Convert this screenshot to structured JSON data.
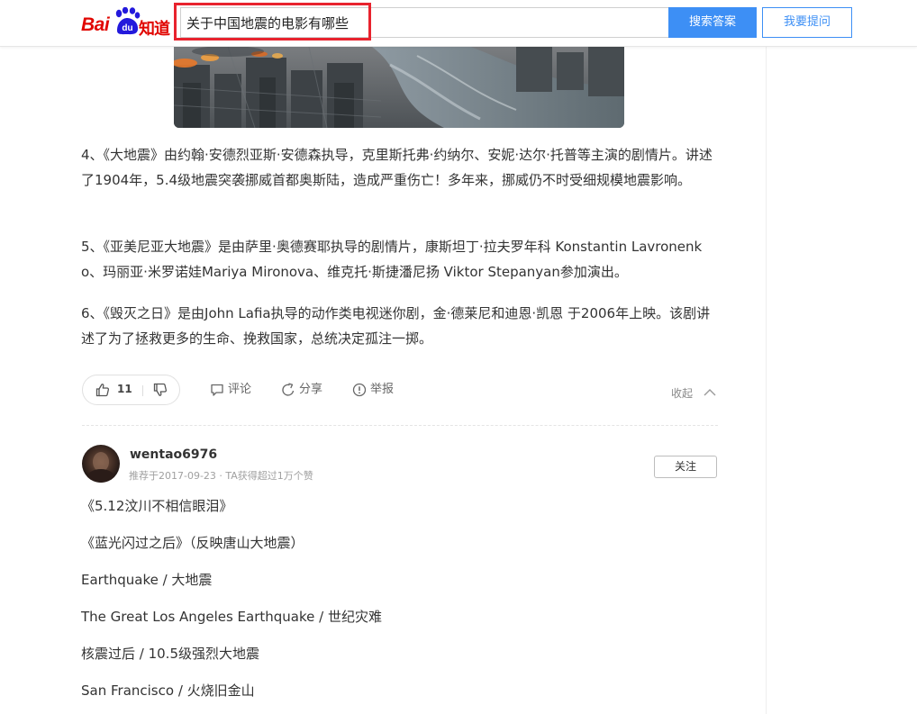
{
  "header": {
    "logo_text_bai": "Bai",
    "logo_text_du": "du",
    "logo_text_zhidao": "知道",
    "search_value": "关于中国地震的电影有哪些",
    "search_button": "搜索答案",
    "ask_button": "我要提问"
  },
  "answer1": {
    "paragraphs": [
      "4、《大地震》由约翰·安德烈亚斯·安德森执导，克里斯托弗·约纳尔、安妮·达尔·托普等主演的剧情片。讲述了1904年，5.4级地震突袭挪威首都奥斯陆，造成严重伤亡！多年来，挪威仍不时受细规模地震影响。",
      "5、《亚美尼亚大地震》是由萨里·奥德赛耶执导的剧情片，康斯坦丁·拉夫罗年科 Konstantin Lavronenko、玛丽亚·米罗诺娃Mariya Mironova、维克托·斯捷潘尼扬 Viktor Stepanyan参加演出。",
      "6、《毁灭之日》是由John Lafia执导的动作类电视迷你剧，金·德莱尼和迪恩·凯恩 于2006年上映。该剧讲述了为了拯救更多的生命、挽救国家，总统决定孤注一掷。"
    ],
    "actions": {
      "like_count": "11",
      "comment": "评论",
      "share": "分享",
      "report": "举报",
      "collapse": "收起"
    }
  },
  "answer2": {
    "username": "wentao6976",
    "meta": "推荐于2017-09-23 · TA获得超过1万个赞",
    "follow_button": "关注",
    "lines": [
      "《5.12汶川不相信眼泪》",
      "《蓝光闪过之后》（反映唐山大地震）",
      "Earthquake / 大地震",
      "The Great Los Angeles Earthquake / 世纪灾难",
      "核震过后 / 10.5级强烈大地震",
      "San Francisco / 火烧旧金山"
    ]
  },
  "colors": {
    "brand_red": "#e10601",
    "logo_blue": "#2319dc",
    "accent_blue": "#3d8ff5",
    "highlight_red": "#e8232e"
  }
}
